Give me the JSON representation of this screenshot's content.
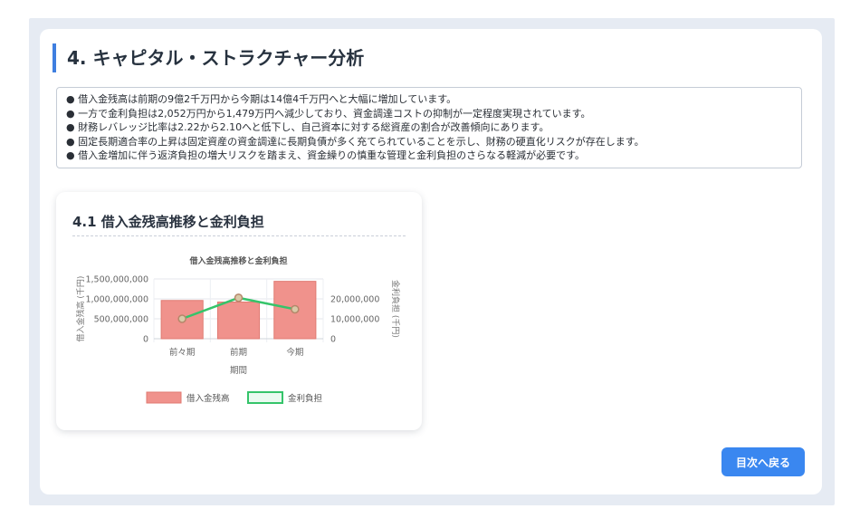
{
  "section": {
    "title": "4. キャピタル・ストラクチャー分析"
  },
  "summary": {
    "bullet": "●",
    "lines": [
      "借入金残高は前期の9億2千万円から今期は14億4千万円へと大幅に増加しています。",
      "一方で金利負担は2,052万円から1,479万円へ減少しており、資金調達コストの抑制が一定程度実現されています。",
      "財務レバレッジ比率は2.22から2.10へと低下し、自己資本に対する総資産の割合が改善傾向にあります。",
      "固定長期適合率の上昇は固定資産の資金調達に長期負債が多く充てられていることを示し、財務の硬直化リスクが存在します。",
      "借入金増加に伴う返済負担の増大リスクを踏まえ、資金繰りの慎重な管理と金利負担のさらなる軽減が必要です。"
    ]
  },
  "chart_card": {
    "heading": "4.1 借入金残高推移と金利負担"
  },
  "chart_data": {
    "type": "bar",
    "title": "借入金残高推移と金利負担",
    "categories": [
      "前々期",
      "前期",
      "今期"
    ],
    "xlabel": "期間",
    "ylabel": "借入金残高 (千円)",
    "y2label": "金利負担 (千円)",
    "ylim": [
      0,
      1500000000
    ],
    "y2lim": [
      0,
      30000000
    ],
    "y_ticks": [
      "0",
      "500,000,000",
      "1,000,000,000",
      "1,500,000,000"
    ],
    "y2_ticks": [
      "0",
      "10,000,000",
      "20,000,000"
    ],
    "grid": true,
    "legend_position": "bottom",
    "series": [
      {
        "name": "借入金残高",
        "type": "bar",
        "axis": "left",
        "color": "#f0928c",
        "border": "#e07a72",
        "values": [
          960000000,
          920000000,
          1440000000
        ]
      },
      {
        "name": "金利負担",
        "type": "line",
        "axis": "right",
        "color": "#35c46a",
        "point_color": "#b5876a",
        "values": [
          10000000,
          20520000,
          14790000
        ]
      }
    ]
  },
  "nav": {
    "back_label": "目次へ戻る"
  }
}
